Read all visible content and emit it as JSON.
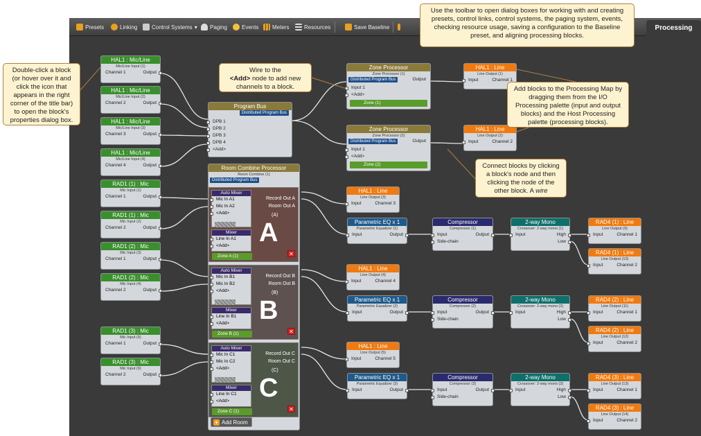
{
  "toolbar": {
    "presets": "Presets",
    "linking": "Linking",
    "control_systems": "Control Systems",
    "paging": "Paging",
    "events": "Events",
    "meters": "Meters",
    "resources": "Resources",
    "save_baseline": "Save Baseline",
    "tab_processing": "Processing"
  },
  "callouts": {
    "toolbar_help": "Use the toolbar to open dialog boxes for working with and creating presets, control links, control systems, the paging system, events, checking resource usage, saving a configuration to the Baseline preset, and aligning processing blocks.",
    "dblclick_help": "Double-click a block (or hover over it and click the icon that appears in the right corner of the title bar) to open the block's properties dialog box.",
    "add_help_1": "Wire to the",
    "add_help_bold": "<Add>",
    "add_help_2": "node to add new channels to a block.",
    "addblocks_help": "Add blocks to the Processing Map by dragging them from the I/O Processing palette (input and output blocks) and the Host Processing palette (processing blocks).",
    "connect_help_1": "Connect blocks by clicking a block's node and then clicking the node of the other block. A",
    "connect_help_wire": "wire"
  },
  "labels": {
    "input": "Input",
    "output": "Output",
    "add": "<Add>",
    "side_chain": "Side-chain",
    "high": "High",
    "low": "Low",
    "dist_bus": "Distributed Program Bus",
    "channel_1": "Channel 1",
    "channel_2": "Channel 2",
    "input_1": "Input 1",
    "auto_mixer": "Auto Mixer",
    "mixer": "Mixer",
    "record_out": "Record Out",
    "room_out": "Room Out",
    "add_room": "Add Room"
  },
  "inputs": [
    {
      "title": "HAL1 : Mic/Line",
      "sub": "Mic/Line Input (1)",
      "ch": "Channel 1"
    },
    {
      "title": "HAL1 : Mic/Line",
      "sub": "Mic/Line Input (2)",
      "ch": "Channel 2"
    },
    {
      "title": "HAL1 : Mic/Line",
      "sub": "Mic/Line Input (3)",
      "ch": "Channel 3"
    },
    {
      "title": "HAL1 : Mic/Line",
      "sub": "Mic/Line Input (4)",
      "ch": "Channel 4"
    },
    {
      "title": "RAD1 (1) : Mic",
      "sub": "Mic Input (1)",
      "ch": "Channel 1"
    },
    {
      "title": "RAD1 (1) : Mic",
      "sub": "Mic Input (2)",
      "ch": "Channel 2"
    },
    {
      "title": "RAD1 (2) : Mic",
      "sub": "Mic Input (3)",
      "ch": "Channel 1"
    },
    {
      "title": "RAD1 (2) : Mic",
      "sub": "Mic Input (4)",
      "ch": "Channel 2"
    },
    {
      "title": "RAD1 (3) : Mic",
      "sub": "Mic Input (5)",
      "ch": "Channel 1"
    },
    {
      "title": "RAD1 (3) : Mic",
      "sub": "Mic Input (6)",
      "ch": "Channel 2"
    }
  ],
  "program_bus": {
    "title": "Program Bus",
    "rows": [
      "DPB 1",
      "DPB 2",
      "DPB 3",
      "DPB 4",
      "<Add>"
    ]
  },
  "zone_processors": [
    {
      "title": "Zone Processor",
      "sub": "Zone Processor (1)",
      "zone": "Zone (1)"
    },
    {
      "title": "Zone Processor",
      "sub": "Zone Processor (2)",
      "zone": "Zone (2)"
    }
  ],
  "zone_outputs": [
    {
      "title": "HAL1 : Line",
      "sub": "Line Output (1)",
      "ch": "Channel 1"
    },
    {
      "title": "HAL1 : Line",
      "sub": "Line Output (2)",
      "ch": "Channel 2"
    }
  ],
  "room_combine": {
    "title": "Room Combine Processor",
    "sub": "Room Combine (1)"
  },
  "rooms": [
    {
      "letter": "A",
      "paren": "(A)",
      "mic1": "Mic In A1",
      "mic2": "Mic In A2",
      "line": "Line In A1",
      "rec": "Record Out A",
      "room": "Room Out A",
      "zone": "Zone A (1)"
    },
    {
      "letter": "B",
      "paren": "(B)",
      "mic1": "Mic In B1",
      "mic2": "Mic In B2",
      "line": "Line In B1",
      "rec": "Record Out B",
      "room": "Room Out B",
      "zone": "Zone B (1)"
    },
    {
      "letter": "C",
      "paren": "(C)",
      "mic1": "Mic In C1",
      "mic2": "Mic In C2",
      "line": "Line In C1",
      "rec": "Record Out C",
      "room": "Room Out C",
      "zone": "Zone C (1)"
    }
  ],
  "chains": [
    {
      "rec": {
        "title": "HAL1 : Line",
        "sub": "Line Output (3)",
        "ch": "Channel 3"
      },
      "eq": {
        "title": "Parametric EQ x 1",
        "sub": "Parametric Equalizer (1)"
      },
      "comp": {
        "title": "Compressor",
        "sub": "Compressor (1)"
      },
      "xo": {
        "title": "2-way Mono",
        "sub": "Crossover: 2-way mono (1)"
      },
      "out1": {
        "title": "RAD4 (1) : Line",
        "sub": "Line Output (9)",
        "ch": "Channel 1"
      },
      "out2": {
        "title": "RAD4 (1) : Line",
        "sub": "Line Output (10)",
        "ch": "Channel 2"
      }
    },
    {
      "rec": {
        "title": "HAL1 : Line",
        "sub": "Line Output (4)",
        "ch": "Channel 4"
      },
      "eq": {
        "title": "Parametric EQ x 1",
        "sub": "Parametric Equalizer (2)"
      },
      "comp": {
        "title": "Compressor",
        "sub": "Compressor (2)"
      },
      "xo": {
        "title": "2-way Mono",
        "sub": "Crossover: 2-way mono (2)"
      },
      "out1": {
        "title": "RAD4 (2) : Line",
        "sub": "Line Output (11)",
        "ch": "Channel 1"
      },
      "out2": {
        "title": "RAD4 (2) : Line",
        "sub": "Line Output (12)",
        "ch": "Channel 2"
      }
    },
    {
      "rec": {
        "title": "HAL1 : Line",
        "sub": "Line Output (5)",
        "ch": "Channel 5"
      },
      "eq": {
        "title": "Parametric EQ x 1",
        "sub": "Parametric Equalizer (3)"
      },
      "comp": {
        "title": "Compressor",
        "sub": "Compressor (3)"
      },
      "xo": {
        "title": "2-way Mono",
        "sub": "Crossover: 2-way mono (3)"
      },
      "out1": {
        "title": "RAD4 (3) : Line",
        "sub": "Line Output (13)",
        "ch": "Channel 1"
      },
      "out2": {
        "title": "RAD4 (3) : Line",
        "sub": "Line Output (14)",
        "ch": "Channel 2"
      }
    }
  ]
}
